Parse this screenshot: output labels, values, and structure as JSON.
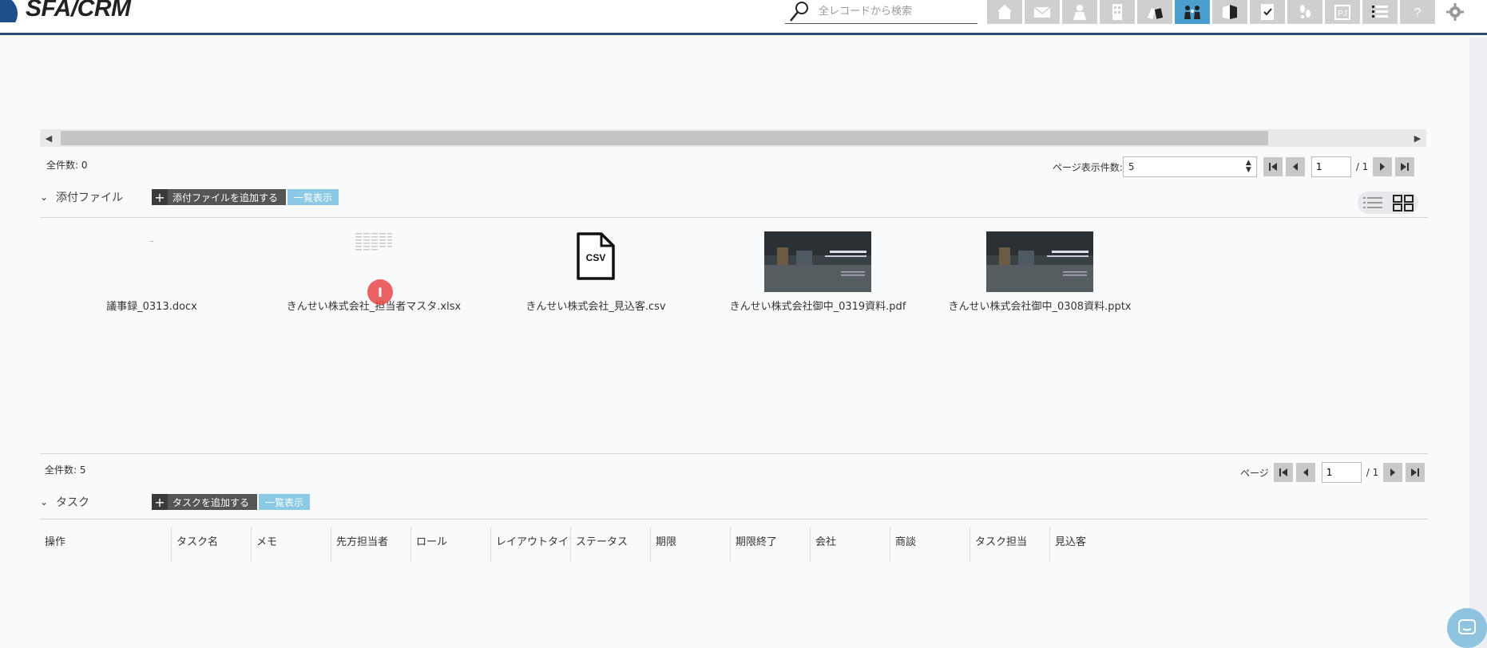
{
  "header": {
    "logo_text": "SFA/CRM",
    "search_placeholder": "全レコードから検索",
    "nav_items": [
      {
        "icon": "home-icon",
        "active": false
      },
      {
        "icon": "mail-icon",
        "active": false
      },
      {
        "icon": "person-icon",
        "active": false
      },
      {
        "icon": "building-icon",
        "active": false
      },
      {
        "icon": "deal-icon",
        "active": false
      },
      {
        "icon": "contacts-icon",
        "active": true
      },
      {
        "icon": "book-icon",
        "active": false
      },
      {
        "icon": "task-check-icon",
        "active": false
      },
      {
        "icon": "footprint-icon",
        "active": false
      },
      {
        "icon": "project-icon",
        "active": false,
        "text": "PJ"
      },
      {
        "icon": "list-icon",
        "active": false
      },
      {
        "icon": "help-icon",
        "active": false,
        "text": "?"
      },
      {
        "icon": "gear-icon",
        "active": false
      }
    ],
    "colors": {
      "accent": "#4a9fce",
      "border": "#2d4a75",
      "nav_bg": "#cfcfcf"
    }
  },
  "top_pager": {
    "count_label": "全件数: 0",
    "per_page_label": "ページ表示件数:",
    "per_page_value": "5",
    "page_value": "1",
    "total_pages": "/ 1"
  },
  "attachments": {
    "title": "添付ファイル",
    "add_label": "添付ファイルを追加する",
    "list_label": "一覧表示",
    "files": [
      {
        "name": "議事録_0313.docx",
        "thumb": "blank"
      },
      {
        "name": "きんせい株式会社_担当者マスタ.xlsx",
        "thumb": "sheet"
      },
      {
        "name": "きんせい株式会社_見込客.csv",
        "thumb": "csv",
        "badge": "CSV"
      },
      {
        "name": "きんせい株式会社御中_0319資料.pdf",
        "thumb": "photo"
      },
      {
        "name": "きんせい株式会社御中_0308資料.pptx",
        "thumb": "photo"
      }
    ],
    "cursor_glyph": "I"
  },
  "bottom_pager": {
    "count_label": "全件数: 5",
    "page_label": "ページ",
    "page_value": "1",
    "total_pages": "/ 1"
  },
  "tasks": {
    "title": "タスク",
    "add_label": "タスクを追加する",
    "list_label": "一覧表示",
    "columns": [
      "操作",
      "タスク名",
      "メモ",
      "先方担当者",
      "ロール",
      "レイアウトタイプ",
      "ステータス",
      "期限",
      "期限終了",
      "会社",
      "商談",
      "タスク担当",
      "見込客"
    ]
  }
}
